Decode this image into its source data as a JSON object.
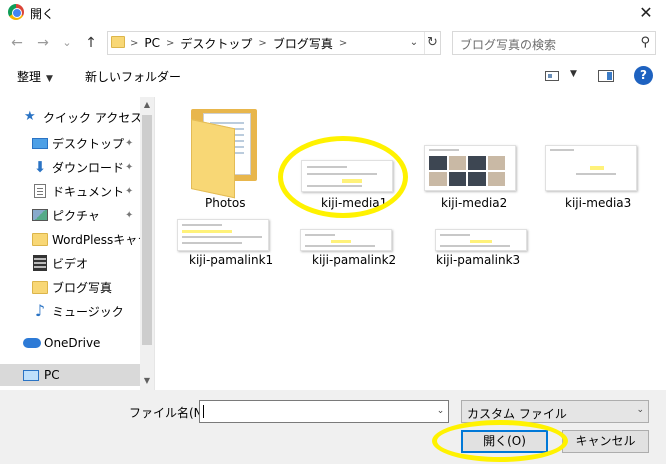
{
  "window": {
    "title": "開く",
    "close_glyph": "✕"
  },
  "nav": {
    "back_glyph": "←",
    "forward_glyph": "→",
    "recent_glyph": "⌄",
    "up_glyph": "↑",
    "crumbs": [
      "PC",
      "デスクトップ",
      "ブログ写真"
    ],
    "separator": ">",
    "refresh_glyph": "↻",
    "dropdown_glyph": "⌄",
    "search_placeholder": "ブログ写真の検索",
    "search_glyph": "⚲"
  },
  "toolbar": {
    "organize_label": "整理",
    "organize_arrow": "▼",
    "new_folder_label": "新しいフォルダー",
    "help_label": "?",
    "view_arrow": "▼"
  },
  "sidebar": {
    "items": [
      {
        "label": "クイック アクセス",
        "icon": "star-icon"
      },
      {
        "label": "デスクトップ",
        "icon": "desktop-icon",
        "pinned": true
      },
      {
        "label": "ダウンロード",
        "icon": "download-icon",
        "pinned": true
      },
      {
        "label": "ドキュメント",
        "icon": "document-icon",
        "pinned": true
      },
      {
        "label": "ピクチャ",
        "icon": "pictures-icon",
        "pinned": true
      },
      {
        "label": "WordPlessキャラク",
        "icon": "folder-icon"
      },
      {
        "label": "ビデオ",
        "icon": "video-icon"
      },
      {
        "label": "ブログ写真",
        "icon": "folder-icon"
      },
      {
        "label": "ミュージック",
        "icon": "music-icon"
      },
      {
        "label": "OneDrive",
        "icon": "cloud-icon"
      },
      {
        "label": "PC",
        "icon": "pc-icon",
        "selected": true
      }
    ],
    "pin_glyph": "📌",
    "scroll_up_glyph": "▲",
    "scroll_down_glyph": "▼"
  },
  "files": [
    {
      "name": "Photos",
      "type": "folder"
    },
    {
      "name": "kiji-media1",
      "type": "image"
    },
    {
      "name": "kiji-media2",
      "type": "image"
    },
    {
      "name": "kiji-media3",
      "type": "image"
    },
    {
      "name": "kiji-pamalink1",
      "type": "image"
    },
    {
      "name": "kiji-pamalink2",
      "type": "image"
    },
    {
      "name": "kiji-pamalink3",
      "type": "image"
    }
  ],
  "footer": {
    "filename_label": "ファイル名(N):",
    "filename_value": "",
    "filetype_value": "カスタム ファイル",
    "open_label": "開く(O)",
    "cancel_label": "キャンセル",
    "dropdown_glyph": "⌄"
  },
  "colors": {
    "annotation": "#fff200",
    "accent": "#0078d7",
    "folder": "#f8d775"
  }
}
